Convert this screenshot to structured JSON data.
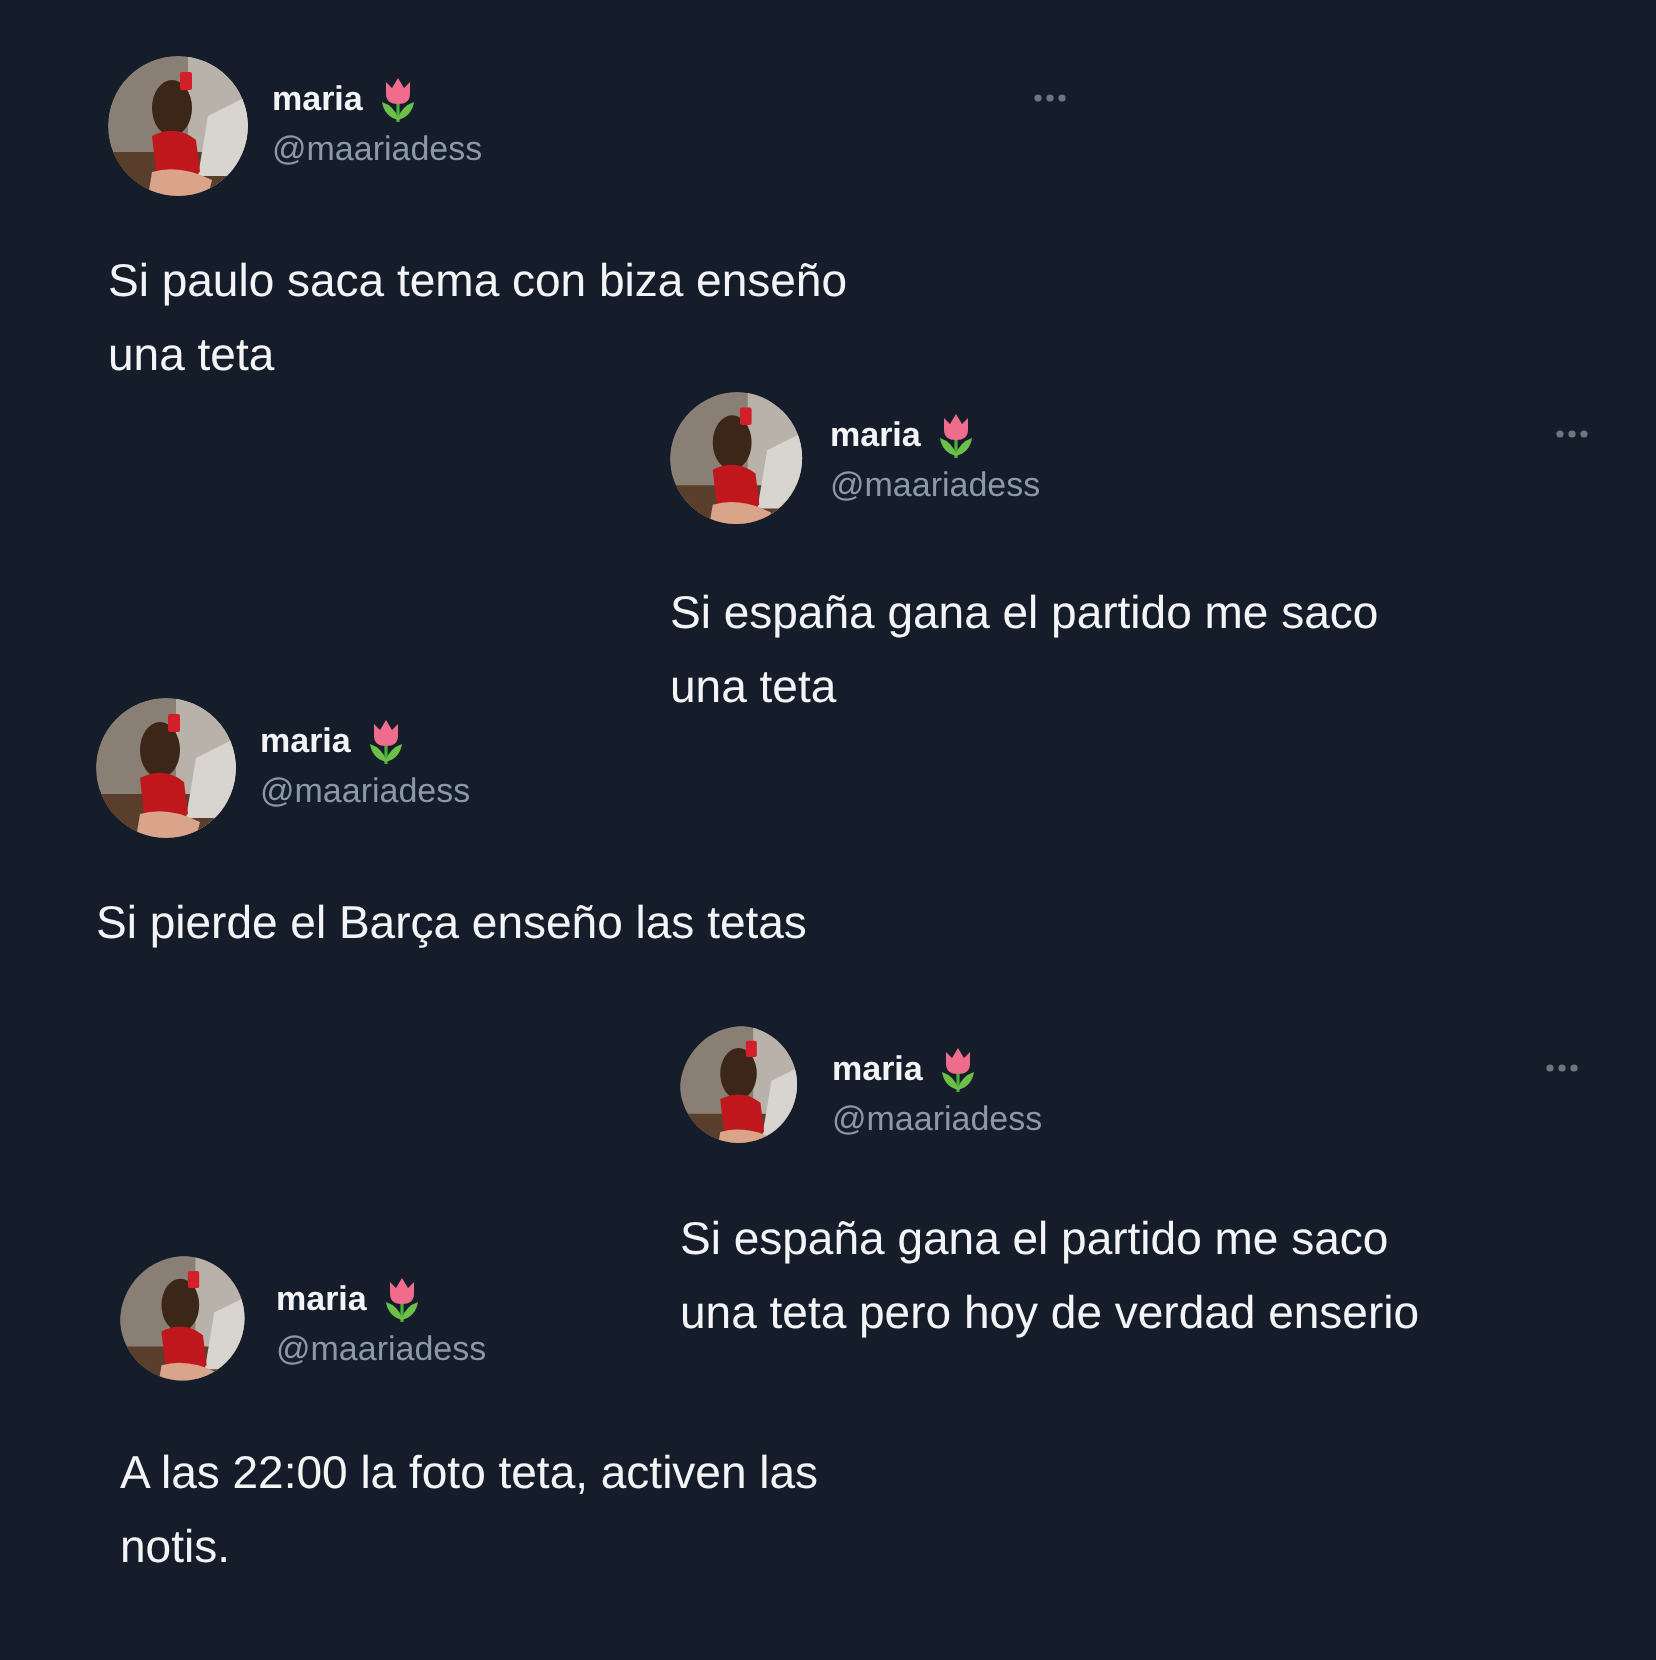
{
  "tweets": [
    {
      "name": "maria",
      "handle": "@maariadess",
      "text": "Si paulo saca tema con biza enseño\nuna teta",
      "menu": true
    },
    {
      "name": "maria",
      "handle": "@maariadess",
      "text": "Si españa gana el partido me saco\nuna teta",
      "menu": true
    },
    {
      "name": "maria",
      "handle": "@maariadess",
      "text": "Si pierde el Barça enseño las tetas",
      "menu": false
    },
    {
      "name": "maria",
      "handle": "@maariadess",
      "text": "Si españa gana el partido me saco\nuna teta pero hoy de verdad enserio",
      "menu": true
    },
    {
      "name": "maria",
      "handle": "@maariadess",
      "text": "A las 22:00 la foto teta, activen las\nnotis.",
      "menu": false
    }
  ]
}
